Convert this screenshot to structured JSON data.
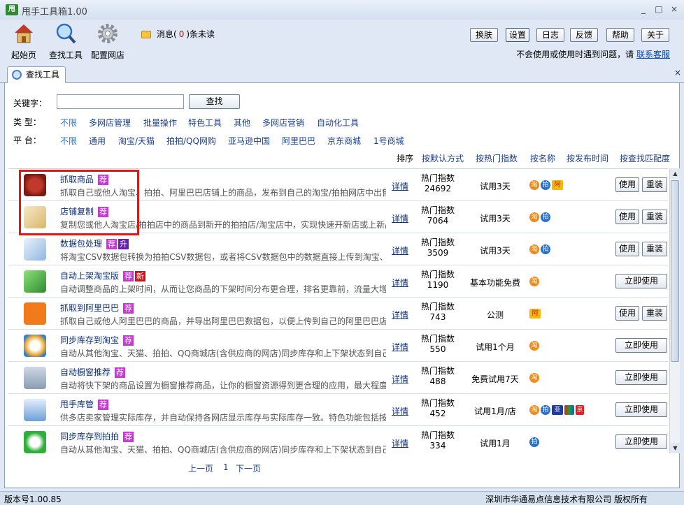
{
  "window": {
    "logo_text": "甩",
    "title": "甩手工具箱1.00",
    "controls": [
      "_",
      "□",
      "×"
    ]
  },
  "toolbar": {
    "items": [
      {
        "label": "起始页",
        "icon": "home-icon"
      },
      {
        "label": "查找工具",
        "icon": "magnifier-icon"
      },
      {
        "label": "配置网店",
        "icon": "gear-icon"
      }
    ],
    "message_prefix": "消息(",
    "message_count": "0",
    "message_suffix": ")条未读"
  },
  "top_buttons": [
    "换肤",
    "设置",
    "日志",
    "反馈",
    "帮助",
    "关于"
  ],
  "help": {
    "text": "不会使用或使用时遇到问题，请",
    "link": "联系客服"
  },
  "tab": {
    "label": "查找工具",
    "close": "×"
  },
  "search": {
    "keyword_label": "关键字：",
    "keyword_value": "",
    "search_button": "查找",
    "type_label": "类  型：",
    "types": [
      "不限",
      "多网店管理",
      "批量操作",
      "特色工具",
      "其他",
      "多网店营销",
      "自动化工具"
    ],
    "platform_label": "平  台：",
    "platforms": [
      "不限",
      "通用",
      "淘宝/天猫",
      "拍拍/QQ网购",
      "亚马逊中国",
      "阿里巴巴",
      "京东商城",
      "1号商城"
    ]
  },
  "sort": {
    "label": "排序",
    "options": [
      "按默认方式",
      "按热门指数",
      "按名称",
      "按发布时间",
      "按查找匹配度"
    ]
  },
  "tools": [
    {
      "name": "抓取商品",
      "badges": [
        "荐"
      ],
      "desc": "抓取自己或他人淘宝、拍拍、阿里巴巴店铺上的商品，发布到自己的淘宝/拍拍网店中出售",
      "detail": "详情",
      "hot_label": "热门指数",
      "hot": "24692",
      "trial": "试用3天",
      "shops": [
        "淘",
        "拍",
        "阿"
      ],
      "buttons": [
        "使用",
        "重装"
      ]
    },
    {
      "name": "店铺复制",
      "badges": [
        "荐"
      ],
      "desc": "复制您或他人淘宝店/拍拍店中的商品到新开的拍拍店/淘宝店中，实现快速开新店或上新品",
      "detail": "详情",
      "hot_label": "热门指数",
      "hot": "7064",
      "trial": "试用3天",
      "shops": [
        "淘",
        "拍"
      ],
      "buttons": [
        "使用",
        "重装"
      ]
    },
    {
      "name": "数据包处理",
      "badges": [
        "荐",
        "升"
      ],
      "desc": "将淘宝CSV数据包转换为拍拍CSV数据包，或者将CSV数据包中的数据直接上传到淘宝、拍拍",
      "detail": "详情",
      "hot_label": "热门指数",
      "hot": "3509",
      "trial": "试用3天",
      "shops": [
        "淘",
        "拍"
      ],
      "buttons": [
        "使用",
        "重装"
      ]
    },
    {
      "name": "自动上架淘宝版",
      "badges": [
        "荐",
        "新"
      ],
      "desc": "自动调整商品的上架时间，从而让您商品的下架时间分布更合理，排名更靠前，流量大增",
      "detail": "详情",
      "hot_label": "热门指数",
      "hot": "1190",
      "trial": "基本功能免费",
      "shops": [
        "淘"
      ],
      "buttons": [
        "立即使用"
      ]
    },
    {
      "name": "抓取到阿里巴巴",
      "badges": [
        "荐"
      ],
      "desc": "抓取自己或他人阿里巴巴的商品，并导出阿里巴巴数据包，以便上传到自己的阿里巴巴店铺",
      "detail": "详情",
      "hot_label": "热门指数",
      "hot": "743",
      "trial": "公测",
      "shops": [
        "阿"
      ],
      "buttons": [
        "使用",
        "重装"
      ]
    },
    {
      "name": "同步库存到淘宝",
      "badges": [
        "荐"
      ],
      "desc": "自动从其他淘宝、天猫、拍拍、QQ商城店(含供应商的网店)同步库存和上下架状态到自己的淘宝店",
      "detail": "详情",
      "hot_label": "热门指数",
      "hot": "550",
      "trial": "试用1个月",
      "shops": [
        "淘"
      ],
      "buttons": [
        "立即使用"
      ]
    },
    {
      "name": "自动橱窗推荐",
      "badges": [
        "荐"
      ],
      "desc": "自动将快下架的商品设置为橱窗推荐商品，让你的橱窗资源得到更合理的应用，最大程度提升流量",
      "detail": "详情",
      "hot_label": "热门指数",
      "hot": "488",
      "trial": "免费试用7天",
      "shops": [
        "淘"
      ],
      "buttons": [
        "立即使用"
      ]
    },
    {
      "name": "甩手库管",
      "badges": [
        "荐"
      ],
      "desc": "供多店卖家管理实际库存，并自动保持各网店显示库存与实际库存一致。特色功能包括按供应商管理",
      "detail": "详情",
      "hot_label": "热门指数",
      "hot": "452",
      "trial": "试用1月/店",
      "shops": [
        "淘",
        "拍",
        "亚",
        "阿",
        "京"
      ],
      "buttons": [
        "立即使用"
      ]
    },
    {
      "name": "同步库存到拍拍",
      "badges": [
        "荐"
      ],
      "desc": "自动从其他淘宝、天猫、拍拍、QQ商城店(含供应商的网店)同步库存和上下架状态到自己的拍拍店",
      "detail": "详情",
      "hot_label": "热门指数",
      "hot": "334",
      "trial": "试用1月",
      "shops": [
        "拍"
      ],
      "buttons": [
        "立即使用"
      ]
    }
  ],
  "pager": {
    "prev": "上一页",
    "page": "1",
    "next": "下一页"
  },
  "status": {
    "version": "版本号1.00.85",
    "copyright": "深圳市华通易点信息技术有限公司 版权所有"
  },
  "colors": {
    "accent": "#d81a1a",
    "link": "#1a3f8c",
    "badge_recommend": "#c43bd1"
  }
}
